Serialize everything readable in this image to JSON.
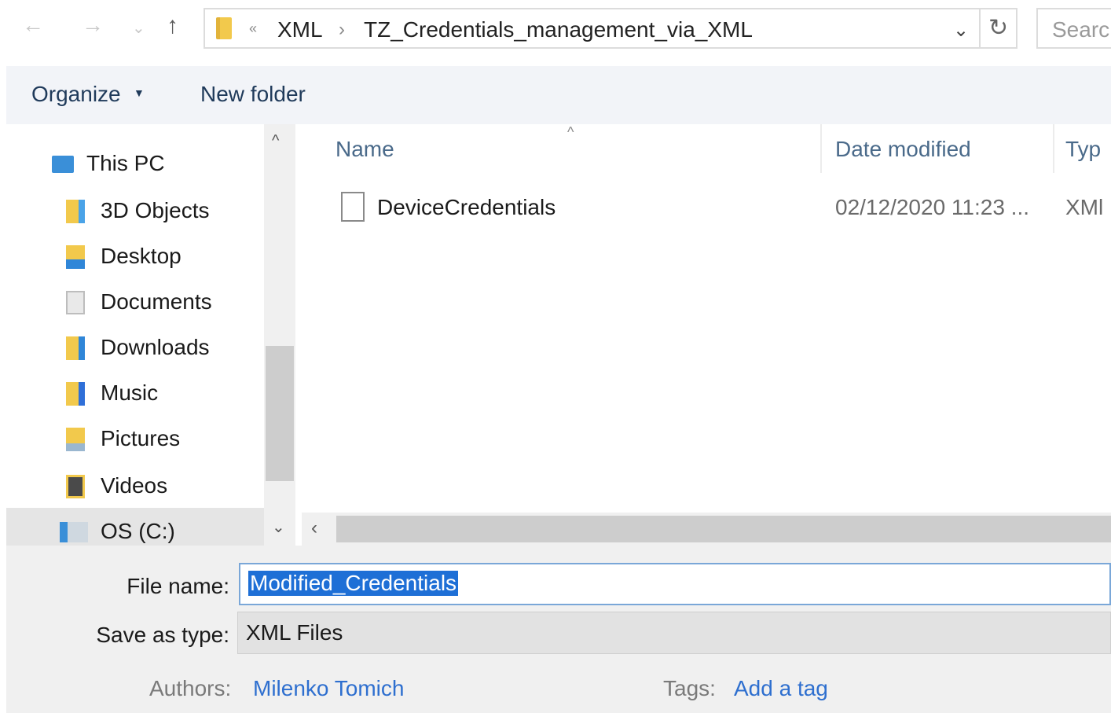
{
  "nav": {
    "back_icon": "back-arrow",
    "forward_icon": "forward-arrow",
    "recent_icon": "recent-locations-chevron",
    "up_icon": "up-arrow",
    "breadcrumb": {
      "overflow": "«",
      "items": [
        "XML",
        "TZ_Credentials_management_via_XML"
      ],
      "separator": "›"
    },
    "search_placeholder": "Search"
  },
  "toolbar": {
    "organize_label": "Organize",
    "new_folder_label": "New folder"
  },
  "sidebar": {
    "items": [
      {
        "label": "This PC",
        "icon": "computer-icon"
      },
      {
        "label": "3D Objects",
        "icon": "3d-objects-icon"
      },
      {
        "label": "Desktop",
        "icon": "desktop-folder-icon"
      },
      {
        "label": "Documents",
        "icon": "documents-folder-icon"
      },
      {
        "label": "Downloads",
        "icon": "downloads-folder-icon"
      },
      {
        "label": "Music",
        "icon": "music-folder-icon"
      },
      {
        "label": "Pictures",
        "icon": "pictures-folder-icon"
      },
      {
        "label": "Videos",
        "icon": "videos-folder-icon"
      },
      {
        "label": "OS (C:)",
        "icon": "drive-icon"
      }
    ]
  },
  "file_list": {
    "columns": {
      "name": "Name",
      "date": "Date modified",
      "type": "Typ"
    },
    "rows": [
      {
        "name": "DeviceCredentials",
        "date": "02/12/2020 11:23 ...",
        "type": "XMl"
      }
    ]
  },
  "form": {
    "filename_label": "File name:",
    "filename_value": "Modified_Credentials",
    "type_label": "Save as type:",
    "type_value": "XML Files",
    "authors_label": "Authors:",
    "authors_value": "Milenko Tomich",
    "tags_label": "Tags:",
    "tags_value": "Add a tag"
  },
  "colors": {
    "accent": "#1e6fd6",
    "link": "#2e6fcf",
    "command_bar": "#f2f4f8",
    "folder": "#f2c94c"
  }
}
